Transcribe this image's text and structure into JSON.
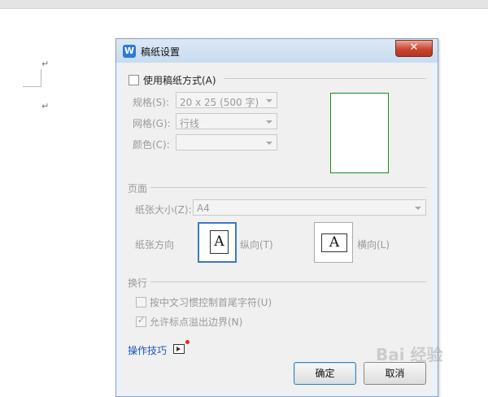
{
  "document": {
    "paragraph_mark": "↵"
  },
  "dialog": {
    "title": "稿纸设置",
    "app_icon": "W",
    "close_symbol": "✕",
    "use_manuscript": {
      "label": "使用稿纸方式(A)",
      "checked": false
    },
    "spec": {
      "label": "规格(S):",
      "value": "20 x 25 (500 字)"
    },
    "grid": {
      "label": "网格(G):",
      "value": "行线"
    },
    "color": {
      "label": "颜色(C):",
      "value": ""
    },
    "page_section": {
      "title": "页面",
      "paper_size_label": "纸张大小(Z):",
      "paper_size_value": "A4",
      "orientation_label": "纸张方向",
      "portrait_label": "纵向(T)",
      "landscape_label": "横向(L)",
      "page_glyph": "A",
      "selected_orientation": "portrait"
    },
    "wrap_section": {
      "title": "换行",
      "option1": {
        "label": "按中文习惯控制首尾字符(U)",
        "checked": false
      },
      "option2": {
        "label": "允许标点溢出边界(N)",
        "checked": true
      },
      "checkmark": "✓"
    },
    "tips_link": "操作技巧",
    "ok_button": "确定",
    "cancel_button": "取消"
  },
  "watermark": "Bai 经验"
}
